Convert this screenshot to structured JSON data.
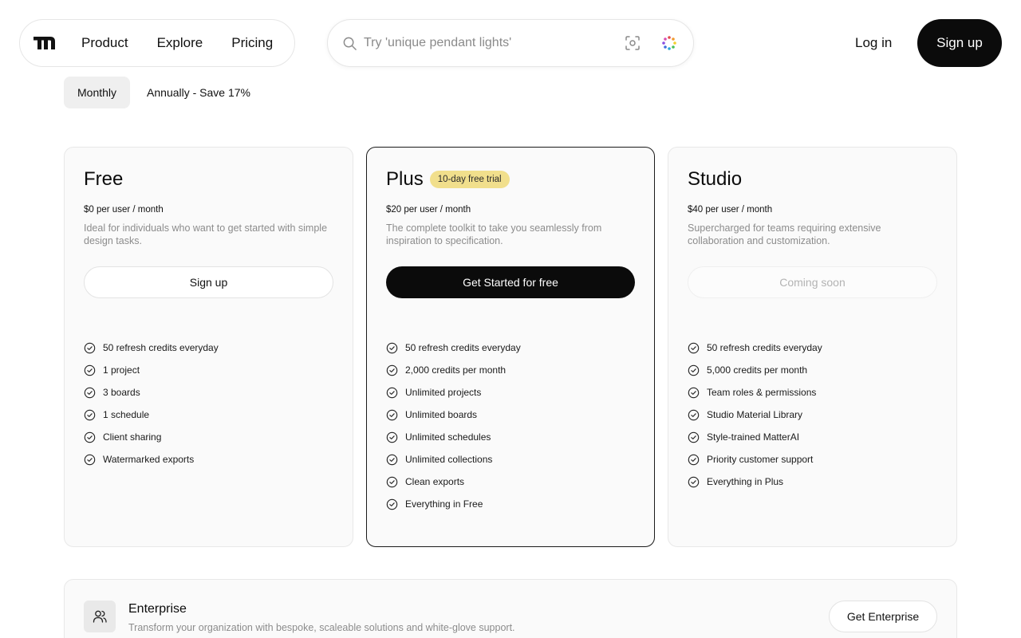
{
  "header": {
    "nav_links": [
      "Product",
      "Explore",
      "Pricing"
    ],
    "search_placeholder": "Try 'unique pendant lights'",
    "login_label": "Log in",
    "signup_label": "Sign up"
  },
  "billing": {
    "monthly_label": "Monthly",
    "annual_label": "Annually - Save 17%",
    "selected": "Monthly"
  },
  "plans": [
    {
      "name": "Free",
      "price": "$0 per user / month",
      "description": "Ideal for individuals who want to get started with simple design tasks.",
      "cta": "Sign up",
      "features": [
        "50 refresh credits everyday",
        "1 project",
        "3 boards",
        "1 schedule",
        "Client sharing",
        "Watermarked exports"
      ]
    },
    {
      "name": "Plus",
      "badge": "10-day free trial",
      "price": "$20 per user / month",
      "description": "The complete toolkit to take you seamlessly from inspiration to specification.",
      "cta": "Get Started for free",
      "features": [
        "50 refresh credits everyday",
        "2,000 credits per month",
        "Unlimited projects",
        "Unlimited boards",
        "Unlimited schedules",
        "Unlimited collections",
        "Clean exports",
        "Everything in Free"
      ]
    },
    {
      "name": "Studio",
      "price": "$40 per user / month",
      "description": "Supercharged for teams requiring extensive collaboration and customization.",
      "cta": "Coming soon",
      "features": [
        "50 refresh credits everyday",
        "5,000 credits per month",
        "Team roles & permissions",
        "Studio Material Library",
        "Style-trained MatterAI",
        "Priority customer support",
        "Everything in Plus"
      ]
    }
  ],
  "enterprise": {
    "title": "Enterprise",
    "description": "Transform your organization with bespoke, scaleable solutions and white-glove support.",
    "cta": "Get Enterprise"
  },
  "colors": {
    "primary_dark": "#0b0b0b",
    "badge_yellow": "#f1df8c",
    "muted_text": "#8c8c8c"
  },
  "icons": [
    "brand-logo-icon",
    "search-icon",
    "visual-search-icon",
    "loading-spinner-icon",
    "check-circle-icon",
    "users-icon"
  ]
}
